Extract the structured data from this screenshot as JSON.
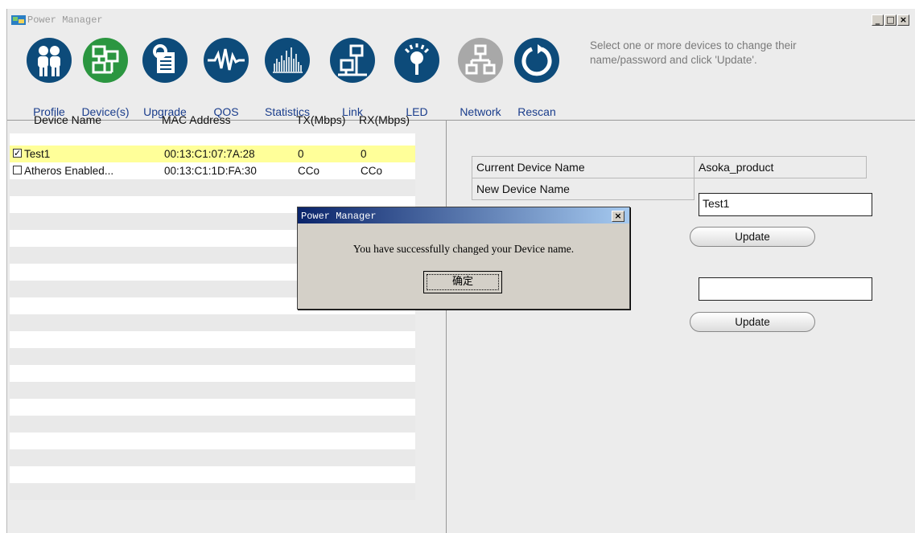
{
  "window": {
    "title": "Power Manager",
    "minimize": "_",
    "maximize": "□",
    "close": "×"
  },
  "toolbar": {
    "items": [
      {
        "label": "Profile",
        "icon": "people-icon",
        "color": "#0d4b7a"
      },
      {
        "label": "Device(s)",
        "icon": "devices-icon",
        "color": "#2b9640"
      },
      {
        "label": "Upgrade",
        "icon": "upgrade-icon",
        "color": "#0d4b7a"
      },
      {
        "label": "QOS",
        "icon": "waveform-icon",
        "color": "#0d4b7a"
      },
      {
        "label": "Statistics",
        "icon": "bar-chart-icon",
        "color": "#0d4b7a"
      },
      {
        "label": "Link",
        "icon": "link-icon",
        "color": "#0d4b7a"
      },
      {
        "label": "LED",
        "icon": "led-icon",
        "color": "#0d4b7a"
      },
      {
        "label": "Network",
        "icon": "network-icon",
        "color": "#a8a8a8"
      },
      {
        "label": "Rescan",
        "icon": "rescan-icon",
        "color": "#0d4b7a"
      }
    ],
    "hint": "Select one or more devices to change their name/password and click 'Update'."
  },
  "device_list": {
    "columns": [
      "Device Name",
      "MAC Address",
      "TX(Mbps)",
      "RX(Mbps)"
    ],
    "rows": [
      {
        "checked": true,
        "name": "Test1",
        "mac": "00:13:C1:07:7A:28",
        "tx": "0",
        "rx": "0"
      },
      {
        "checked": false,
        "name": "Atheros Enabled...",
        "mac": "00:13:C1:1D:FA:30",
        "tx": "CCo",
        "rx": "CCo"
      }
    ],
    "check_mark": "✓",
    "selected_color": "#ffff99",
    "stripe_color": "#e9e9e9"
  },
  "device_panel": {
    "current_name_label": "Current Device Name",
    "current_name_value": "Asoka_product",
    "new_name_label": "New Device Name",
    "new_name_value": "Test1",
    "update_label": "Update",
    "password_value": "",
    "update2_label": "Update"
  },
  "dialog": {
    "title": "Power Manager",
    "close": "×",
    "message": "You have successfully changed your Device name.",
    "ok_label": "确定"
  }
}
